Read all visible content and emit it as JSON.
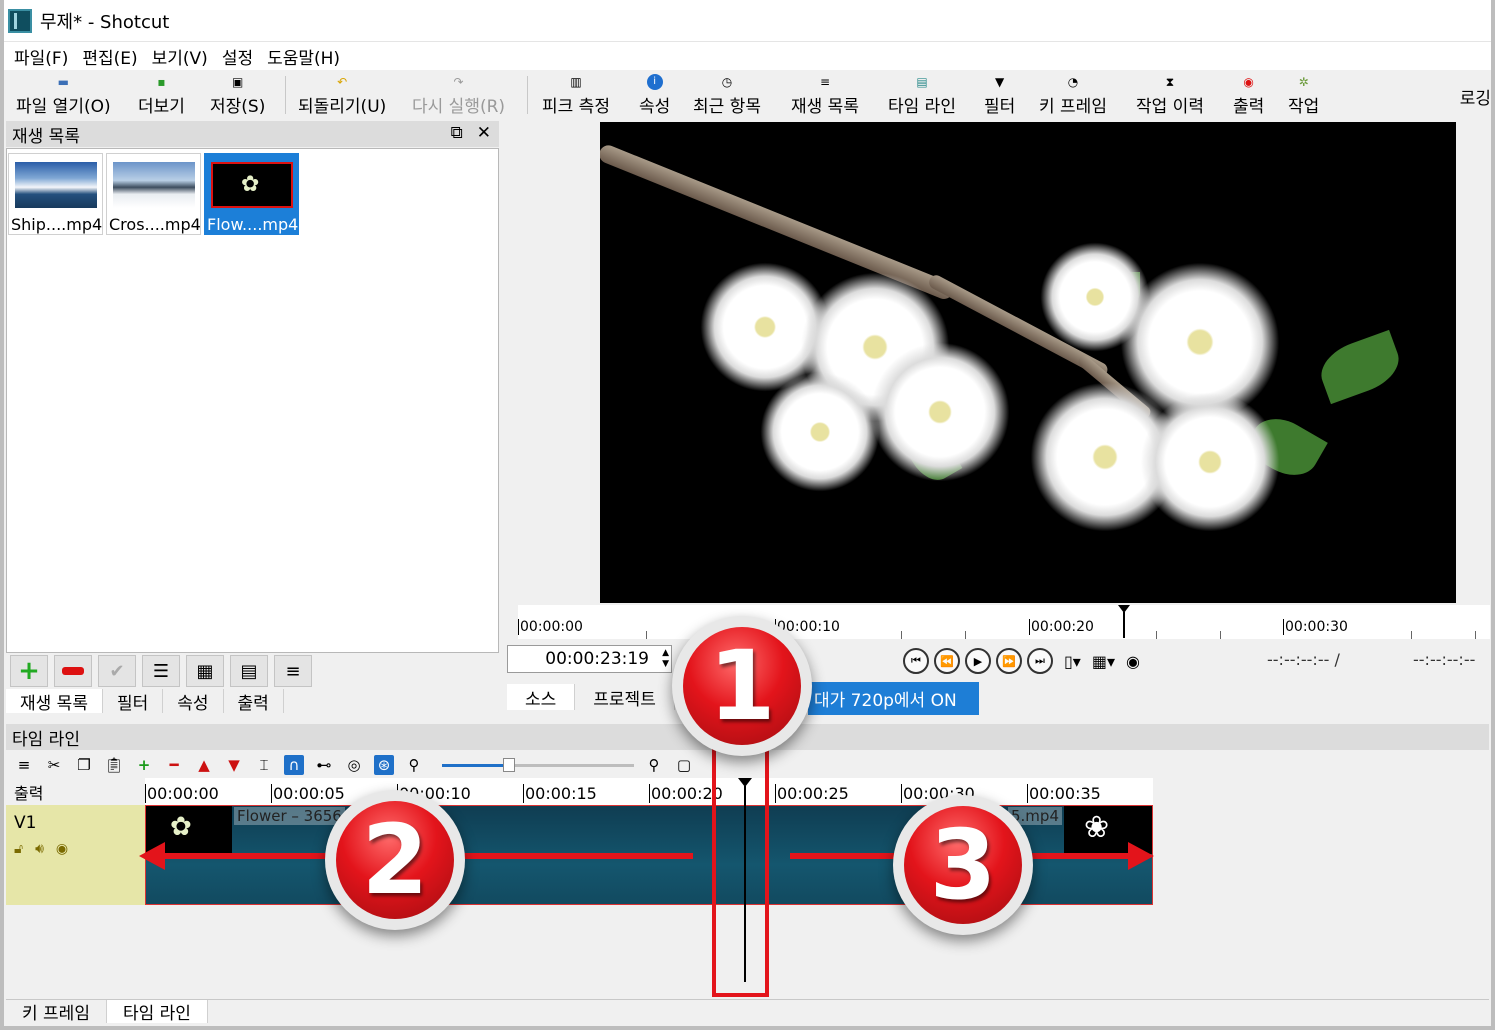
{
  "window": {
    "title": "무제* - Shotcut",
    "login": "로깅"
  },
  "menu": [
    "파일(F)",
    "편집(E)",
    "보기(V)",
    "설정",
    "도움말(H)"
  ],
  "toolbar": {
    "open": "파일 열기(O)",
    "more": "더보기",
    "save": "저장(S)",
    "undo": "되돌리기(U)",
    "redo": "다시 실행(R)",
    "peak": "피크 측정",
    "properties": "속성",
    "recent": "최근 항목",
    "playlist": "재생 목록",
    "timeline": "타임 라인",
    "filter": "필터",
    "keyframes": "키 프레임",
    "history": "작업 이력",
    "export": "출력",
    "jobs": "작업"
  },
  "playlist_panel": {
    "title": "재생 목록",
    "clips": [
      {
        "caption": "Ship....mp4",
        "selected": false
      },
      {
        "caption": "Cros....mp4",
        "selected": false
      },
      {
        "caption": "Flow....mp4",
        "selected": true
      }
    ],
    "tabs": [
      "재생 목록",
      "필터",
      "속성",
      "출력"
    ],
    "active_tab": "재생 목록"
  },
  "player": {
    "ruler_labels": [
      "00:00:00",
      "00:00:10",
      "00:00:20",
      "00:00:30"
    ],
    "timecode": "00:00:23:19",
    "duration_a": "--:--:--:-- /",
    "duration_b": "--:--:--:--",
    "tabs": [
      "소스",
      "프로젝트"
    ],
    "active_tab": "소스",
    "banner": "대가 720p에서 ON"
  },
  "timeline": {
    "title": "타임 라인",
    "output_label": "출력",
    "track_name": "V1",
    "ruler_labels": [
      "00:00:00",
      "00:00:05",
      "00:00:10",
      "00:00:15",
      "00:00:20",
      "00:00:25",
      "00:00:30",
      "00:00:35"
    ],
    "clip_left_name": "Flower – 3656",
    "clip_right_name": "5.mp4",
    "zoom_fraction": 0.35
  },
  "bottom_tabs": [
    "키 프레임",
    "타임 라인"
  ],
  "annotations": {
    "badge1": "1",
    "badge2": "2",
    "badge3": "3"
  },
  "colors": {
    "annotation_red": "#e3141b",
    "selection_blue": "#1c7fd8",
    "clip_teal": "#14566e",
    "track_header": "#e6e6a8"
  }
}
